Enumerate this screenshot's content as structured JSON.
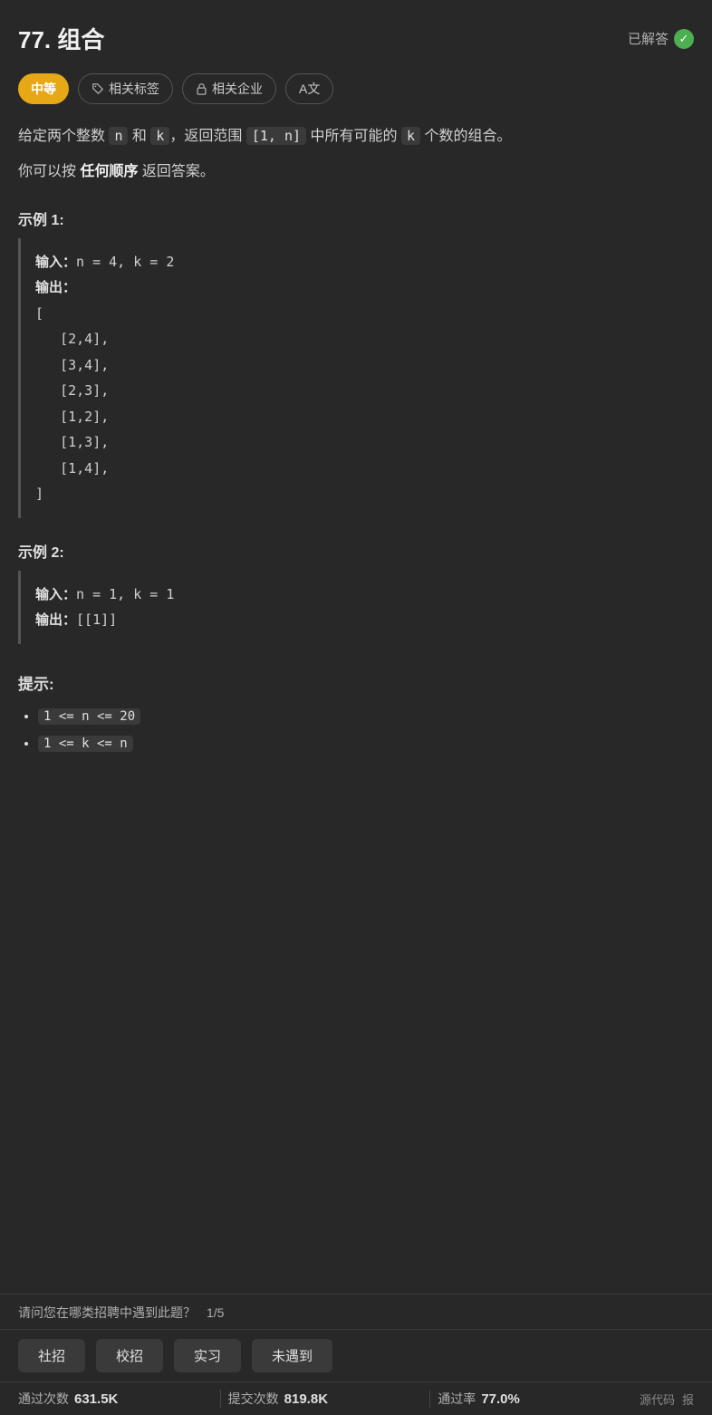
{
  "header": {
    "title": "77. 组合",
    "solved_label": "已解答"
  },
  "tags": [
    {
      "id": "difficulty",
      "label": "中等",
      "type": "difficulty"
    },
    {
      "id": "related-tags",
      "label": "相关标签",
      "type": "outline",
      "icon": "tag"
    },
    {
      "id": "related-company",
      "label": "相关企业",
      "type": "outline",
      "icon": "lock"
    },
    {
      "id": "font-size",
      "label": "A文",
      "type": "outline",
      "icon": ""
    }
  ],
  "description_parts": [
    "给定两个整数 ",
    "n",
    " 和 ",
    "k",
    "，返回范围 ",
    "[1, n]",
    " 中所有可能的 ",
    "k",
    " 个数的组合。"
  ],
  "description2": "你可以按 任何顺序 返回答案。",
  "examples": [
    {
      "id": 1,
      "title": "示例 1:",
      "lines": [
        "输入：n = 4, k = 2",
        "输出：",
        "[",
        "   [2,4],",
        "   [3,4],",
        "   [2,3],",
        "   [1,2],",
        "   [1,3],",
        "   [1,4],",
        "]"
      ]
    },
    {
      "id": 2,
      "title": "示例 2:",
      "lines": [
        "输入：n = 1, k = 1",
        "输出：[[1]]"
      ]
    }
  ],
  "hints": {
    "title": "提示:",
    "items": [
      "1 <= n <= 20",
      "1 <= k <= n"
    ]
  },
  "bottom": {
    "recruitment_question": "请问您在哪类招聘中遇到此题？",
    "recruitment_count": "1/5",
    "buttons": [
      "社招",
      "校招",
      "实习",
      "未遇到"
    ],
    "stats": [
      {
        "label": "通过次数",
        "value": "631.5K"
      },
      {
        "label": "提交次数",
        "value": "819.8K"
      },
      {
        "label": "通过率",
        "value": "77.0%"
      }
    ],
    "source_label": "源代码",
    "report_label": "报"
  }
}
